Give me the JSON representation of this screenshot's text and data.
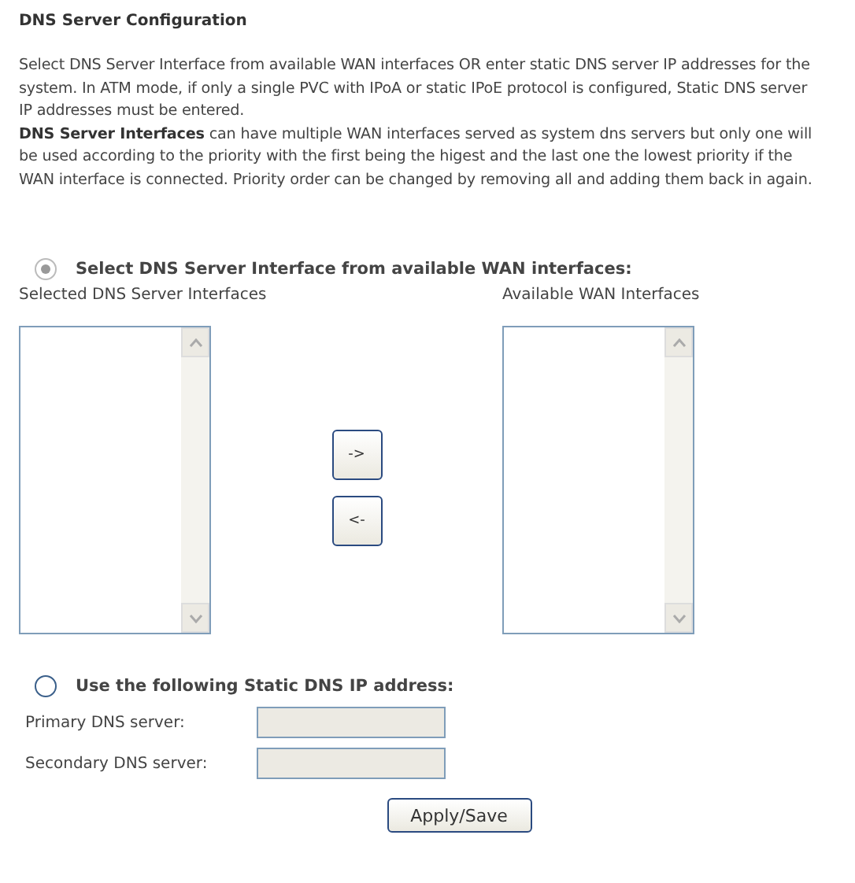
{
  "title": "DNS Server Configuration",
  "paragraphs": [
    "Select DNS Server Interface from available WAN interfaces OR enter static DNS server IP addresses for the system. In ATM mode, if only a single PVC with IPoA or static IPoE protocol is configured, Static DNS server IP addresses must be entered.",
    "**DNS Server Interfaces** can have multiple WAN interfaces served as system dns servers but only one will be used according to the priority with the first being the higest and the last one the lowest priority if the WAN interface is connected. Priority order can be changed by removing all and adding them back in again."
  ],
  "interface_option": {
    "label": "Select DNS Server Interface from available WAN interfaces:",
    "selected": true,
    "disabled": true
  },
  "selected_list": {
    "label": "Selected DNS Server Interfaces"
  },
  "available_list": {
    "label": "Available WAN Interfaces"
  },
  "move_buttons": [
    "->",
    "<-"
  ],
  "static_option": {
    "label": "Use the following Static DNS IP address:",
    "selected": false,
    "disabled": false
  },
  "fields": [
    {
      "label": "Primary DNS server:",
      "disabled": true
    },
    {
      "label": "Secondary DNS server:",
      "disabled": true
    }
  ],
  "apply_button": "Apply/Save"
}
